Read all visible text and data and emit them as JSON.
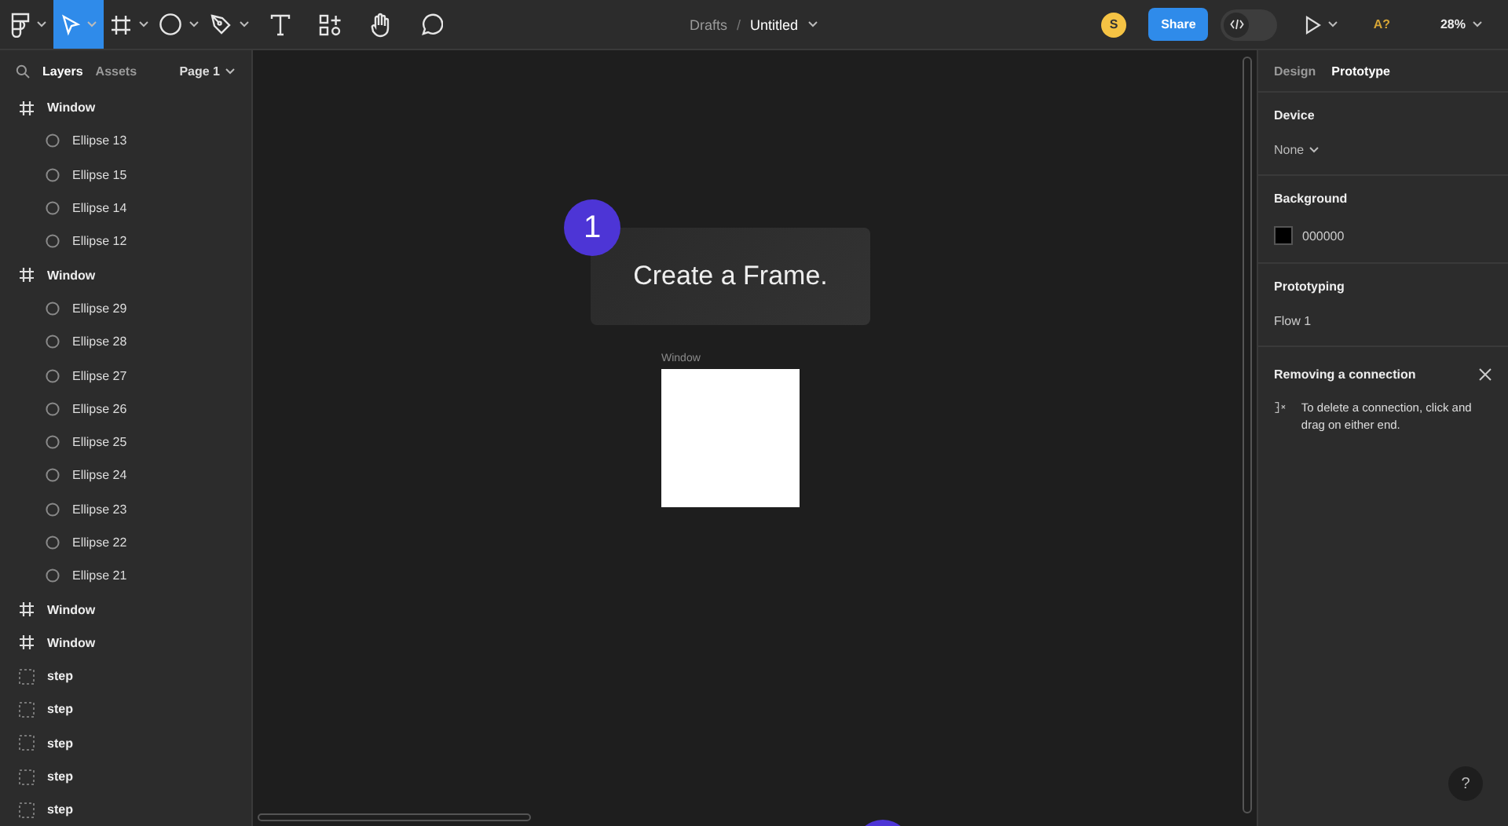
{
  "toolbar": {
    "tools": [
      {
        "kind": "menu",
        "selected": false,
        "dropdown": true
      },
      {
        "kind": "move",
        "selected": true,
        "dropdown": true
      },
      {
        "kind": "frame",
        "selected": false,
        "dropdown": true
      },
      {
        "kind": "ellipse",
        "selected": false,
        "dropdown": true
      },
      {
        "kind": "pen",
        "selected": false,
        "dropdown": true
      },
      {
        "kind": "text",
        "selected": false,
        "dropdown": false
      },
      {
        "kind": "resources",
        "selected": false,
        "dropdown": false
      },
      {
        "kind": "hand",
        "selected": false,
        "dropdown": false
      },
      {
        "kind": "comment",
        "selected": false,
        "dropdown": false
      }
    ],
    "breadcrumb": {
      "folder": "Drafts",
      "separator": "/",
      "file": "Untitled"
    },
    "avatar": {
      "initial": "S",
      "color": "#f5c344"
    },
    "share": "Share",
    "dev_mode": {
      "on": false
    },
    "accessibility": "A?",
    "zoom": "28%"
  },
  "layers_panel": {
    "tabs": [
      {
        "label": "Layers",
        "selected": true
      },
      {
        "label": "Assets",
        "selected": false
      }
    ],
    "page": "Page 1",
    "layers": [
      {
        "kind": "frame",
        "name": "Window",
        "children": [
          {
            "kind": "ellipse",
            "name": "Ellipse 13"
          },
          {
            "kind": "ellipse",
            "name": "Ellipse 15"
          },
          {
            "kind": "ellipse",
            "name": "Ellipse 14"
          },
          {
            "kind": "ellipse",
            "name": "Ellipse 12"
          }
        ]
      },
      {
        "kind": "frame",
        "name": "Window",
        "children": [
          {
            "kind": "ellipse",
            "name": "Ellipse 29"
          },
          {
            "kind": "ellipse",
            "name": "Ellipse 28"
          },
          {
            "kind": "ellipse",
            "name": "Ellipse 27"
          },
          {
            "kind": "ellipse",
            "name": "Ellipse 26"
          },
          {
            "kind": "ellipse",
            "name": "Ellipse 25"
          },
          {
            "kind": "ellipse",
            "name": "Ellipse 24"
          },
          {
            "kind": "ellipse",
            "name": "Ellipse 23"
          },
          {
            "kind": "ellipse",
            "name": "Ellipse 22"
          },
          {
            "kind": "ellipse",
            "name": "Ellipse 21"
          }
        ]
      },
      {
        "kind": "frame",
        "name": "Window"
      },
      {
        "kind": "frame",
        "name": "Window"
      },
      {
        "kind": "section",
        "name": "step"
      },
      {
        "kind": "section",
        "name": "step"
      },
      {
        "kind": "section",
        "name": "step"
      },
      {
        "kind": "section",
        "name": "step"
      },
      {
        "kind": "section",
        "name": "step"
      }
    ]
  },
  "canvas": {
    "step": {
      "number": "1",
      "text": "Create a Frame."
    },
    "frame": {
      "label": "Window"
    }
  },
  "properties_panel": {
    "tabs": [
      {
        "label": "Design",
        "selected": false
      },
      {
        "label": "Prototype",
        "selected": true
      }
    ],
    "device": {
      "heading": "Device",
      "value": "None"
    },
    "background": {
      "heading": "Background",
      "color": "#000000",
      "hex": "000000"
    },
    "prototyping": {
      "heading": "Prototyping",
      "flow": "Flow 1"
    },
    "tip": {
      "title": "Removing a connection",
      "text": "To delete a connection, click and drag on either end."
    }
  },
  "help": "?"
}
